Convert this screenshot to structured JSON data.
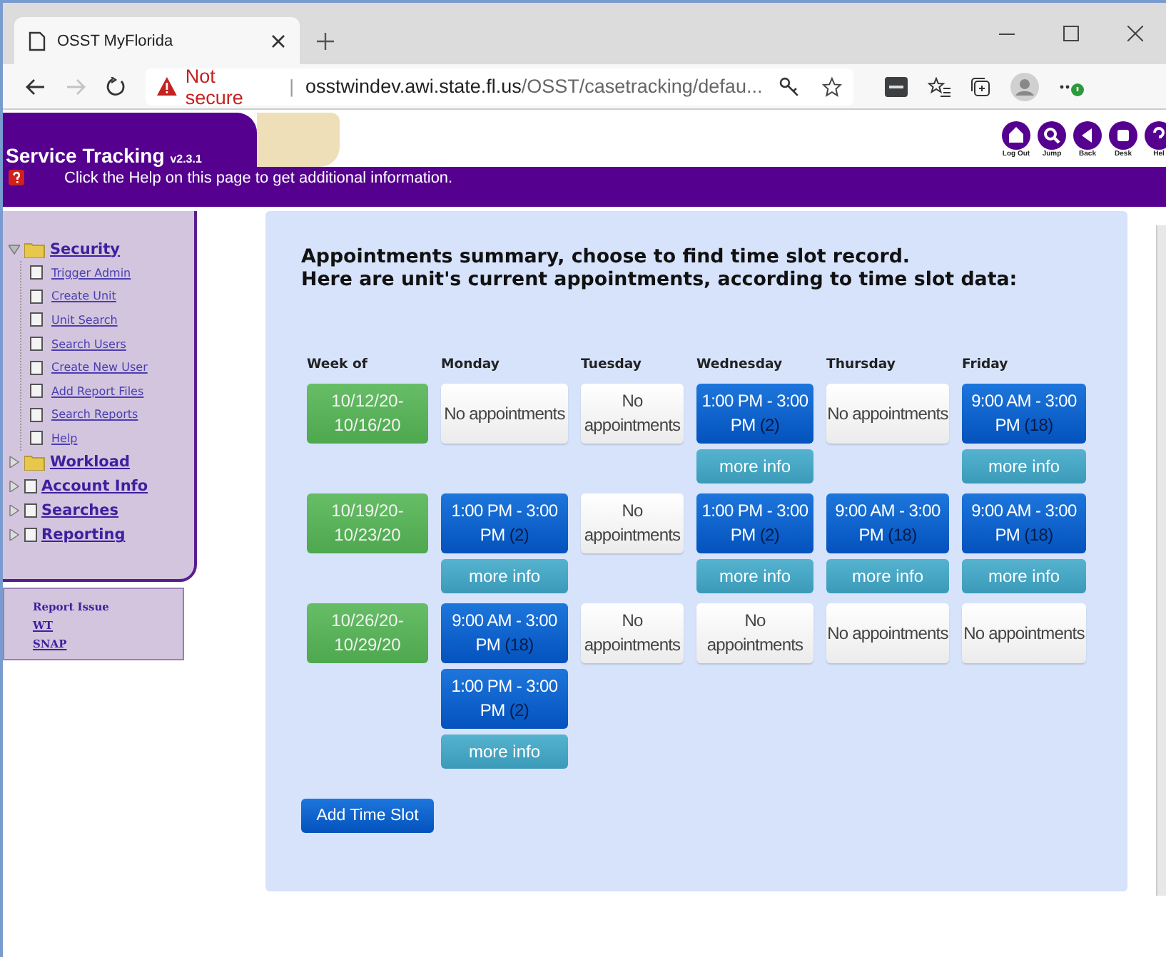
{
  "browser": {
    "tab_title": "OSST MyFlorida",
    "forward_disabled": true,
    "address": {
      "security": "Not secure",
      "separator": "|",
      "host": "osstwindev.awi.state.fl.us",
      "path": "/OSST/casetracking/defau..."
    }
  },
  "header": {
    "title": "Service Tracking",
    "version": "v2.3.1",
    "help_text": "Click the Help on this page to get additional information.",
    "nav_icons": [
      {
        "kind": "home",
        "label": "Log Out"
      },
      {
        "kind": "search",
        "label": "Jump"
      },
      {
        "kind": "back",
        "label": "Back"
      },
      {
        "kind": "stop",
        "label": "Desk"
      },
      {
        "kind": "help",
        "label": "Hel"
      }
    ]
  },
  "sidebar": {
    "tree": [
      {
        "label": "Security",
        "kind": "folder",
        "expanded": true,
        "children": [
          {
            "label": "Trigger Admin"
          },
          {
            "label": "Create Unit"
          },
          {
            "label": "Unit Search"
          },
          {
            "label": "Search Users"
          },
          {
            "label": "Create New User"
          },
          {
            "label": "Add Report Files"
          },
          {
            "label": "Search Reports"
          },
          {
            "label": "Help"
          }
        ]
      },
      {
        "label": "Workload",
        "kind": "folder",
        "expanded": false
      },
      {
        "label": "Account Info",
        "kind": "page",
        "expanded": false
      },
      {
        "label": "Searches",
        "kind": "page",
        "expanded": false
      },
      {
        "label": "Reporting",
        "kind": "page",
        "expanded": false
      }
    ],
    "report": {
      "title": "Report Issue",
      "links": [
        "WT",
        "SNAP"
      ]
    }
  },
  "main": {
    "heading": [
      "Appointments summary, choose to find time slot record.",
      "Here are unit's current appointments, according to time slot data:"
    ],
    "columns": [
      "Week of",
      "Monday",
      "Tuesday",
      "Wednesday",
      "Thursday",
      "Friday"
    ],
    "weeks": [
      {
        "week": [
          "10/12/20-",
          "10/16/20"
        ],
        "days": [
          {
            "slots": [
              {
                "kind": "empty",
                "text": "No appointments"
              }
            ]
          },
          {
            "slots": [
              {
                "kind": "empty",
                "text": "No appointments"
              }
            ]
          },
          {
            "slots": [
              {
                "kind": "slot",
                "time": "1:00 PM - 3:00 PM",
                "count": "(2)"
              }
            ],
            "more_info": "more info"
          },
          {
            "slots": [
              {
                "kind": "empty",
                "text": "No appointments"
              }
            ]
          },
          {
            "slots": [
              {
                "kind": "slot",
                "time": "9:00 AM - 3:00 PM",
                "count": "(18)"
              }
            ],
            "more_info": "more info"
          }
        ]
      },
      {
        "week": [
          "10/19/20-",
          "10/23/20"
        ],
        "days": [
          {
            "slots": [
              {
                "kind": "slot",
                "time": "1:00 PM - 3:00 PM",
                "count": "(2)"
              }
            ],
            "more_info": "more info"
          },
          {
            "slots": [
              {
                "kind": "empty",
                "text": "No appointments"
              }
            ]
          },
          {
            "slots": [
              {
                "kind": "slot",
                "time": "1:00 PM - 3:00 PM",
                "count": "(2)"
              }
            ],
            "more_info": "more info"
          },
          {
            "slots": [
              {
                "kind": "slot",
                "time": "9:00 AM - 3:00 PM",
                "count": "(18)"
              }
            ],
            "more_info": "more info"
          },
          {
            "slots": [
              {
                "kind": "slot",
                "time": "9:00 AM - 3:00 PM",
                "count": "(18)"
              }
            ],
            "more_info": "more info"
          }
        ]
      },
      {
        "week": [
          "10/26/20-",
          "10/29/20"
        ],
        "days": [
          {
            "slots": [
              {
                "kind": "slot",
                "time": "9:00 AM - 3:00 PM",
                "count": "(18)"
              },
              {
                "kind": "slot",
                "time": "1:00 PM - 3:00 PM",
                "count": "(2)"
              }
            ],
            "more_info": "more info"
          },
          {
            "slots": [
              {
                "kind": "empty",
                "text": "No appointments"
              }
            ]
          },
          {
            "slots": [
              {
                "kind": "empty",
                "text": "No appointments"
              }
            ]
          },
          {
            "slots": [
              {
                "kind": "empty",
                "text": "No appointments"
              }
            ]
          },
          {
            "slots": [
              {
                "kind": "empty",
                "text": "No appointments"
              }
            ]
          }
        ]
      }
    ],
    "add_button": "Add Time Slot"
  }
}
